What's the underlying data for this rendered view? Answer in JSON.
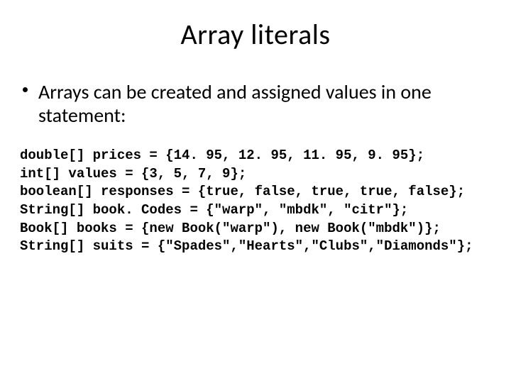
{
  "title": "Array literals",
  "bullet": "Arrays can be created and assigned values in one statement:",
  "code_lines": {
    "l0": "double[] prices = {14. 95, 12. 95, 11. 95, 9. 95};",
    "l1": "int[] values = {3, 5, 7, 9};",
    "l2": "boolean[] responses = {true, false, true, true, false};",
    "l3": "String[] book. Codes = {\"warp\", \"mbdk\", \"citr\"};",
    "l4": "Book[] books = {new Book(\"warp\"), new Book(\"mbdk\")};",
    "l5": "String[] suits = {\"Spades\",\"Hearts\",\"Clubs\",\"Diamonds\"};"
  }
}
